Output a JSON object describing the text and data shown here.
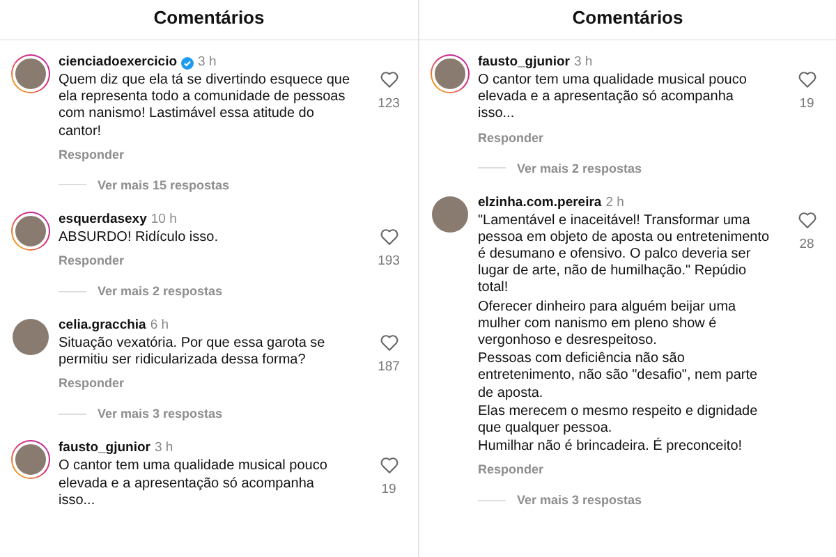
{
  "panels": [
    {
      "title": "Comentários",
      "comments": [
        {
          "user": "cienciadoexercicio",
          "verified": true,
          "story_ring": true,
          "time": "3 h",
          "paragraphs": [
            "Quem diz que ela tá se divertindo esquece que ela representa todo a comunidade de pessoas com nanismo! Lastimável essa atitude do cantor!"
          ],
          "likes": "123",
          "reply": "Responder",
          "more_replies": "Ver mais 15 respostas"
        },
        {
          "user": "esquerdasexy",
          "verified": false,
          "story_ring": true,
          "time": "10 h",
          "paragraphs": [
            "ABSURDO! Ridículo isso."
          ],
          "likes": "193",
          "reply": "Responder",
          "more_replies": "Ver mais 2 respostas"
        },
        {
          "user": "celia.gracchia",
          "verified": false,
          "story_ring": false,
          "time": "6 h",
          "paragraphs": [
            "Situação vexatória. Por que essa garota se permitiu ser ridicularizada dessa forma?"
          ],
          "likes": "187",
          "reply": "Responder",
          "more_replies": "Ver mais 3 respostas"
        },
        {
          "user": "fausto_gjunior",
          "verified": false,
          "story_ring": true,
          "time": "3 h",
          "paragraphs": [
            "O cantor tem uma qualidade musical pouco elevada e a apresentação só acompanha isso..."
          ],
          "likes": "19"
        }
      ]
    },
    {
      "title": "Comentários",
      "comments": [
        {
          "user": "fausto_gjunior",
          "verified": false,
          "story_ring": true,
          "time": "3 h",
          "paragraphs": [
            "O cantor tem uma qualidade musical pouco elevada e a apresentação só acompanha isso..."
          ],
          "likes": "19",
          "reply": "Responder",
          "more_replies": "Ver mais 2 respostas"
        },
        {
          "user": "elzinha.com.pereira",
          "verified": false,
          "story_ring": false,
          "time": "2 h",
          "paragraphs": [
            "\"Lamentável e inaceitável! Transformar uma pessoa em objeto de aposta ou entretenimento é desumano e ofensivo. O palco deveria ser lugar de arte, não de humilhação.\" Repúdio total!",
            "Oferecer dinheiro para alguém beijar uma mulher com nanismo em pleno show é vergonhoso e desrespeitoso.",
            "Pessoas com deficiência não são entretenimento, não são \"desafio\", nem parte de aposta.",
            "Elas merecem o mesmo respeito e dignidade que qualquer pessoa.",
            "Humilhar não é brincadeira. É preconceito!"
          ],
          "likes": "28",
          "reply": "Responder",
          "more_replies": "Ver mais 3 respostas"
        }
      ]
    }
  ]
}
